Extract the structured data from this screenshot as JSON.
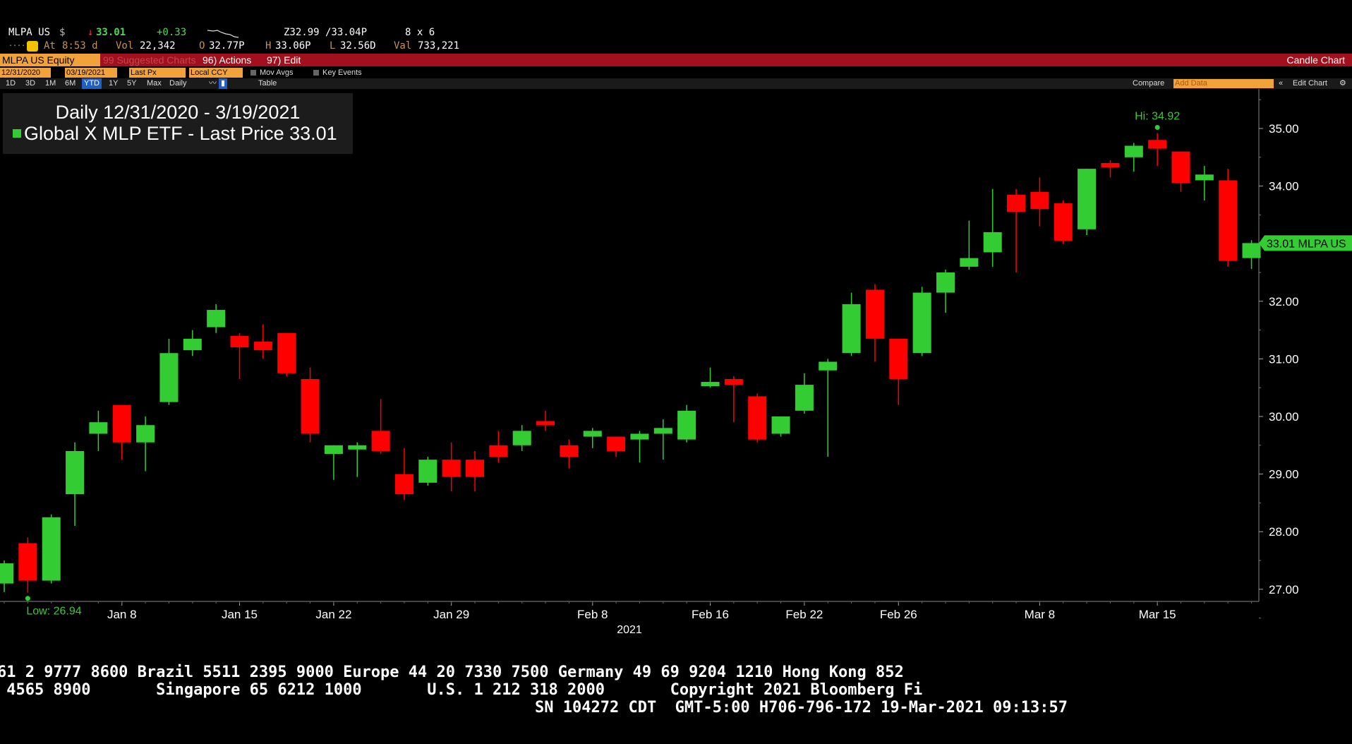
{
  "quote": {
    "ticker": "MLPA US",
    "currency": "$",
    "arrow": "↓",
    "last": "33.01",
    "change": "+0.33",
    "bid_ask": "Z32.99 /33.04P",
    "size": "8 x 6",
    "time_label": "At",
    "time": "8:53 d",
    "vol_label": "Vol",
    "vol": "22,342",
    "open_label": "O",
    "open": "32.77P",
    "high_label": "H",
    "high": "33.06P",
    "low_label": "L",
    "low": "32.56D",
    "val_label": "Val",
    "val": "733,221"
  },
  "function_bar": {
    "security": "MLPA US Equity",
    "suggested": "99 Suggested Charts",
    "actions": "96) Actions",
    "edit": "97) Edit",
    "chart_type": "Candle Chart"
  },
  "settings": {
    "start_date": "12/31/2020",
    "end_date": "03/19/2021",
    "field": "Last Px",
    "currency": "Local CCY",
    "mov_avgs": "Mov Avgs",
    "key_events": "Key Events"
  },
  "toolbar": {
    "periods": [
      "1D",
      "3D",
      "1M",
      "6M",
      "YTD",
      "1Y",
      "5Y",
      "Max"
    ],
    "selected_period": "YTD",
    "frequency": "Daily",
    "table": "Table",
    "compare": "Compare",
    "add_data": "Add Data",
    "edit_chart": "Edit Chart"
  },
  "legend": {
    "title": "Daily 12/31/2020 - 3/19/2021",
    "series": "Global X MLP ETF - Last Price 33.01"
  },
  "chart_data": {
    "type": "candlestick",
    "title": "Daily 12/31/2020 - 3/19/2021",
    "series_name": "Global X MLP ETF - Last Price",
    "ylim": [
      26.2,
      35.7
    ],
    "y_ticks": [
      27.0,
      28.0,
      29.0,
      30.0,
      31.0,
      32.0,
      33.0,
      34.0,
      35.0
    ],
    "x_ticks": [
      {
        "label": "Jan 8",
        "index": 5
      },
      {
        "label": "Jan 15",
        "index": 10
      },
      {
        "label": "Jan 22",
        "index": 14
      },
      {
        "label": "Jan 29",
        "index": 19
      },
      {
        "label": "Feb 8",
        "index": 25
      },
      {
        "label": "Feb 16",
        "index": 30
      },
      {
        "label": "Feb 22",
        "index": 34
      },
      {
        "label": "Feb 26",
        "index": 38
      },
      {
        "label": "Mar 8",
        "index": 44
      },
      {
        "label": "Mar 15",
        "index": 49
      }
    ],
    "year_label": "2021",
    "up_color": "#33cc33",
    "down_color": "#ff0000",
    "candles": [
      {
        "o": 27.1,
        "h": 27.5,
        "l": 26.95,
        "c": 27.45
      },
      {
        "o": 27.8,
        "h": 27.9,
        "l": 26.94,
        "c": 27.15
      },
      {
        "o": 27.15,
        "h": 28.3,
        "l": 27.1,
        "c": 28.25
      },
      {
        "o": 28.65,
        "h": 29.55,
        "l": 28.1,
        "c": 29.4
      },
      {
        "o": 29.7,
        "h": 30.1,
        "l": 29.4,
        "c": 29.9
      },
      {
        "o": 30.2,
        "h": 30.2,
        "l": 29.25,
        "c": 29.55
      },
      {
        "o": 29.55,
        "h": 30.0,
        "l": 29.05,
        "c": 29.85
      },
      {
        "o": 30.25,
        "h": 31.35,
        "l": 30.2,
        "c": 31.1
      },
      {
        "o": 31.15,
        "h": 31.5,
        "l": 31.05,
        "c": 31.35
      },
      {
        "o": 31.55,
        "h": 31.95,
        "l": 31.45,
        "c": 31.85
      },
      {
        "o": 31.4,
        "h": 31.45,
        "l": 30.65,
        "c": 31.2
      },
      {
        "o": 31.3,
        "h": 31.6,
        "l": 31.0,
        "c": 31.15
      },
      {
        "o": 31.45,
        "h": 31.45,
        "l": 30.7,
        "c": 30.75
      },
      {
        "o": 30.65,
        "h": 30.85,
        "l": 29.55,
        "c": 29.7
      },
      {
        "o": 29.35,
        "h": 29.5,
        "l": 28.9,
        "c": 29.5
      },
      {
        "o": 29.45,
        "h": 29.55,
        "l": 28.95,
        "c": 29.5
      },
      {
        "o": 29.75,
        "h": 30.3,
        "l": 29.35,
        "c": 29.4
      },
      {
        "o": 29.0,
        "h": 29.45,
        "l": 28.55,
        "c": 28.65
      },
      {
        "o": 28.85,
        "h": 29.3,
        "l": 28.8,
        "c": 29.25
      },
      {
        "o": 29.25,
        "h": 29.55,
        "l": 28.7,
        "c": 28.95
      },
      {
        "o": 29.25,
        "h": 29.4,
        "l": 28.7,
        "c": 28.95
      },
      {
        "o": 29.5,
        "h": 29.75,
        "l": 29.2,
        "c": 29.3
      },
      {
        "o": 29.5,
        "h": 29.85,
        "l": 29.4,
        "c": 29.75
      },
      {
        "o": 29.92,
        "h": 30.1,
        "l": 29.75,
        "c": 29.88
      },
      {
        "o": 29.5,
        "h": 29.6,
        "l": 29.1,
        "c": 29.3
      },
      {
        "o": 29.65,
        "h": 29.8,
        "l": 29.45,
        "c": 29.75
      },
      {
        "o": 29.65,
        "h": 29.65,
        "l": 29.3,
        "c": 29.4
      },
      {
        "o": 29.6,
        "h": 29.75,
        "l": 29.2,
        "c": 29.7
      },
      {
        "o": 29.7,
        "h": 29.95,
        "l": 29.25,
        "c": 29.8
      },
      {
        "o": 29.6,
        "h": 30.2,
        "l": 29.55,
        "c": 30.1
      },
      {
        "o": 30.55,
        "h": 30.85,
        "l": 30.5,
        "c": 30.6
      },
      {
        "o": 30.65,
        "h": 30.7,
        "l": 29.9,
        "c": 30.55
      },
      {
        "o": 30.35,
        "h": 30.4,
        "l": 29.55,
        "c": 29.6
      },
      {
        "o": 29.7,
        "h": 30.0,
        "l": 29.65,
        "c": 30.0
      },
      {
        "o": 30.1,
        "h": 30.75,
        "l": 30.05,
        "c": 30.55
      },
      {
        "o": 30.8,
        "h": 31.0,
        "l": 29.3,
        "c": 30.95
      },
      {
        "o": 31.1,
        "h": 32.15,
        "l": 31.05,
        "c": 31.95
      },
      {
        "o": 32.2,
        "h": 32.3,
        "l": 30.95,
        "c": 31.35
      },
      {
        "o": 31.35,
        "h": 31.35,
        "l": 30.2,
        "c": 30.65
      },
      {
        "o": 31.1,
        "h": 32.25,
        "l": 31.05,
        "c": 32.15
      },
      {
        "o": 32.15,
        "h": 32.55,
        "l": 31.8,
        "c": 32.5
      },
      {
        "o": 32.6,
        "h": 33.4,
        "l": 32.55,
        "c": 32.75
      },
      {
        "o": 32.85,
        "h": 33.95,
        "l": 32.6,
        "c": 33.2
      },
      {
        "o": 33.85,
        "h": 33.95,
        "l": 32.5,
        "c": 33.55
      },
      {
        "o": 33.9,
        "h": 34.15,
        "l": 33.3,
        "c": 33.6
      },
      {
        "o": 33.7,
        "h": 33.75,
        "l": 33.0,
        "c": 33.05
      },
      {
        "o": 33.25,
        "h": 34.3,
        "l": 33.15,
        "c": 34.3
      },
      {
        "o": 34.4,
        "h": 34.45,
        "l": 34.15,
        "c": 34.35
      },
      {
        "o": 34.5,
        "h": 34.75,
        "l": 34.25,
        "c": 34.7
      },
      {
        "o": 34.8,
        "h": 34.92,
        "l": 34.35,
        "c": 34.65
      },
      {
        "o": 34.6,
        "h": 34.6,
        "l": 33.9,
        "c": 34.05
      },
      {
        "o": 34.1,
        "h": 34.35,
        "l": 33.75,
        "c": 34.2
      },
      {
        "o": 34.1,
        "h": 34.3,
        "l": 32.6,
        "c": 32.7
      },
      {
        "o": 32.75,
        "h": 33.06,
        "l": 32.56,
        "c": 33.01
      }
    ],
    "annotations": {
      "high_label": "Hi: 34.92",
      "low_label": "Low: 26.94",
      "last_tag": "33.01 MLPA US"
    }
  },
  "footer": {
    "line1": "61 2 9777 8600 Brazil 5511 2395 9000 Europe 44 20 7330 7500 Germany 49 69 9204 1210 Hong Kong 852",
    "line2": " 4565 8900       Singapore 65 6212 1000       U.S. 1 212 318 2000       Copyright 2021 Bloomberg Fi",
    "line3": "SN 104272 CDT  GMT-5:00 H706-796-172 19-Mar-2021 09:13:57"
  }
}
